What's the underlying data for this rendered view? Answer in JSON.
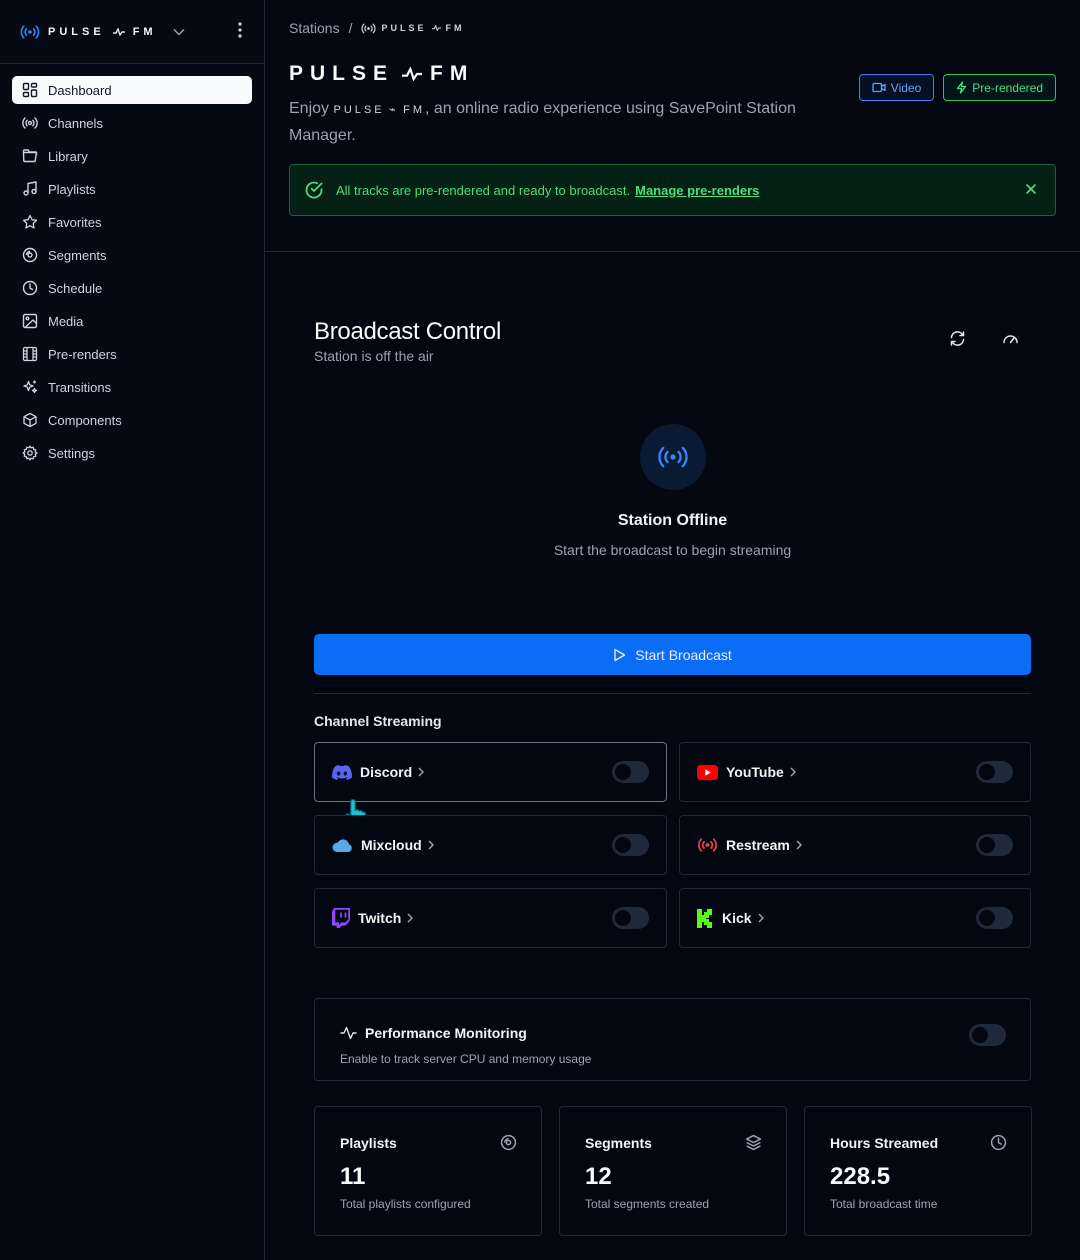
{
  "brand": {
    "name": "PULSE",
    "suffix": "FM"
  },
  "sidebar": {
    "items": [
      {
        "label": "Dashboard",
        "icon": "dashboard-icon",
        "active": true
      },
      {
        "label": "Channels",
        "icon": "broadcast-icon"
      },
      {
        "label": "Library",
        "icon": "folder-icon"
      },
      {
        "label": "Playlists",
        "icon": "music-note-icon"
      },
      {
        "label": "Favorites",
        "icon": "star-icon"
      },
      {
        "label": "Segments",
        "icon": "disc-icon"
      },
      {
        "label": "Schedule",
        "icon": "clock-icon"
      },
      {
        "label": "Media",
        "icon": "image-icon"
      },
      {
        "label": "Pre-renders",
        "icon": "film-icon"
      },
      {
        "label": "Transitions",
        "icon": "sparkles-icon"
      },
      {
        "label": "Components",
        "icon": "box-icon"
      },
      {
        "label": "Settings",
        "icon": "gear-icon"
      }
    ]
  },
  "header": {
    "breadcrumb_root": "Stations",
    "breadcrumb_sep": "/",
    "subtitle_before": "Enjoy",
    "subtitle_after": ", an online radio experience using SavePoint Station Manager.",
    "video_label": "Video",
    "prerendered_label": "Pre-rendered",
    "alert_text": "All tracks are pre-rendered and ready to broadcast.",
    "alert_link": "Manage pre-renders"
  },
  "broadcast": {
    "title": "Broadcast Control",
    "subtitle": "Station is off the air",
    "offline_title": "Station Offline",
    "offline_sub": "Start the broadcast to begin streaming",
    "start_label": "Start Broadcast"
  },
  "channel_streaming": {
    "label": "Channel Streaming",
    "channels": [
      {
        "name": "Discord",
        "icon": "discord-icon",
        "color": "#5865F2",
        "enabled": false
      },
      {
        "name": "YouTube",
        "icon": "youtube-icon",
        "color": "#FF0000",
        "enabled": false
      },
      {
        "name": "Mixcloud",
        "icon": "cloud-icon",
        "color": "#5aa9e6",
        "enabled": false
      },
      {
        "name": "Restream",
        "icon": "broadcast-icon",
        "color": "#ef4444",
        "enabled": false
      },
      {
        "name": "Twitch",
        "icon": "twitch-icon",
        "color": "#9146FF",
        "enabled": false
      },
      {
        "name": "Kick",
        "icon": "kick-icon",
        "color": "#53FC18",
        "enabled": false
      }
    ]
  },
  "performance": {
    "title": "Performance Monitoring",
    "subtitle": "Enable to track server CPU and memory usage",
    "enabled": false
  },
  "stats": [
    {
      "title": "Playlists",
      "value": "11",
      "sub": "Total playlists configured",
      "icon": "disc-icon"
    },
    {
      "title": "Segments",
      "value": "12",
      "sub": "Total segments created",
      "icon": "layers-icon"
    },
    {
      "title": "Hours Streamed",
      "value": "228.5",
      "sub": "Total broadcast time",
      "icon": "clock-icon"
    }
  ],
  "colors": {
    "accent": "#0b6cf5",
    "success": "#4ade80",
    "background": "#030712"
  }
}
